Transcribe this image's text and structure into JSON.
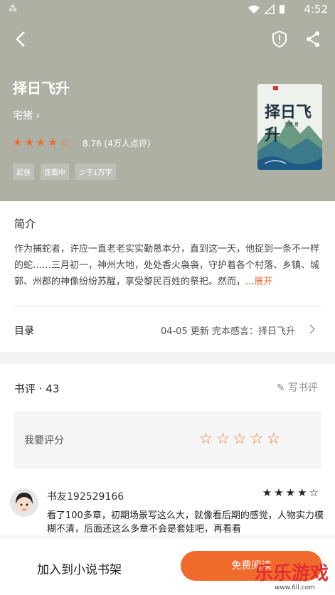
{
  "status": {
    "time": "4:52"
  },
  "book": {
    "title": "择日飞升",
    "author": "宅猪",
    "rating": "8.76",
    "rating_count": "(4万人点评)",
    "tags": [
      "武侠",
      "连载中",
      "少于1万字"
    ],
    "cover": {
      "title": "择日飞升",
      "author": "宅猪 著"
    }
  },
  "intro": {
    "heading": "简介",
    "text": "作为捕蛇者，许应一直老老实实勤恳本分，直到这一天，他捉到一条不一样的蛇……三月初一，神州大地，处处香火袅袅，守护着各个村落、乡镇、城郭、州郡的神像纷纷苏醒，享受黎民百姓的祭祀。然而，...",
    "expand": "展开"
  },
  "toc": {
    "label": "目录",
    "info": "04-05  更新  完本感言：择日飞升"
  },
  "reviews": {
    "title": "书评 · 43",
    "write": "写书评",
    "rate_label": "我要评分",
    "items": [
      {
        "user": "书友192529166",
        "stars": 4,
        "text": "看了100多章，初期场景写这么大，就像看后期的感觉，人物实力模糊不清，后面还这么多章不会是套娃吧，再看看"
      }
    ]
  },
  "bottom": {
    "add_shelf": "加入到小说书架",
    "read": "免费阅读"
  },
  "watermark": {
    "text": "乐乐游戏",
    "url": "www.6ll.com"
  },
  "colors": {
    "accent": "#f06a2c",
    "hero_bg": "#aeb0a4"
  }
}
